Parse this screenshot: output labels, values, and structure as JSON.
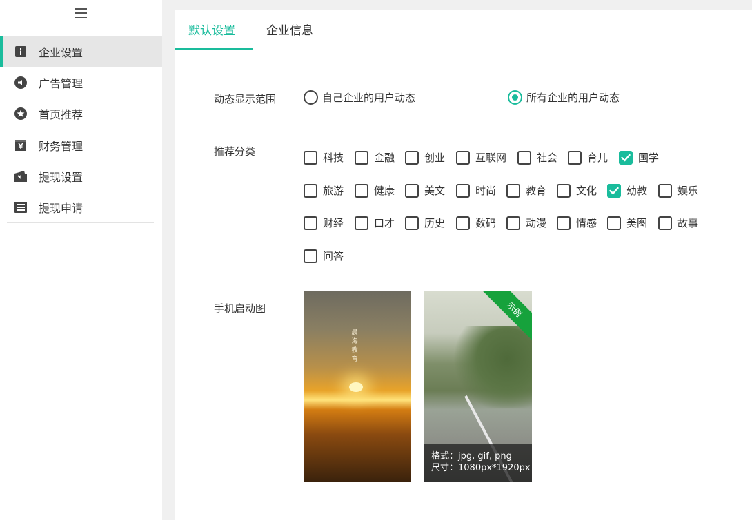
{
  "sidebar": {
    "items": [
      {
        "label": "企业设置",
        "icon": "info-icon"
      },
      {
        "label": "广告管理",
        "icon": "megaphone-icon"
      },
      {
        "label": "首页推荐",
        "icon": "star-icon"
      },
      {
        "label": "财务管理",
        "icon": "yen-icon"
      },
      {
        "label": "提现设置",
        "icon": "wallet-icon"
      },
      {
        "label": "提现申请",
        "icon": "list-icon"
      }
    ]
  },
  "tabs": [
    {
      "label": "默认设置"
    },
    {
      "label": "企业信息"
    }
  ],
  "settings": {
    "scope_label": "动态显示范围",
    "scope_options": [
      {
        "label": "自己企业的用户动态",
        "checked": false
      },
      {
        "label": "所有企业的用户动态",
        "checked": true
      }
    ],
    "category_label": "推荐分类",
    "categories": [
      {
        "label": "科技",
        "checked": false
      },
      {
        "label": "金融",
        "checked": false
      },
      {
        "label": "创业",
        "checked": false
      },
      {
        "label": "互联网",
        "checked": false
      },
      {
        "label": "社会",
        "checked": false
      },
      {
        "label": "育儿",
        "checked": false
      },
      {
        "label": "国学",
        "checked": true
      },
      {
        "label": "旅游",
        "checked": false
      },
      {
        "label": "健康",
        "checked": false
      },
      {
        "label": "美文",
        "checked": false
      },
      {
        "label": "时尚",
        "checked": false
      },
      {
        "label": "教育",
        "checked": false
      },
      {
        "label": "文化",
        "checked": false
      },
      {
        "label": "幼教",
        "checked": true
      },
      {
        "label": "娱乐",
        "checked": false
      },
      {
        "label": "财经",
        "checked": false
      },
      {
        "label": "口才",
        "checked": false
      },
      {
        "label": "历史",
        "checked": false
      },
      {
        "label": "数码",
        "checked": false
      },
      {
        "label": "动漫",
        "checked": false
      },
      {
        "label": "情感",
        "checked": false
      },
      {
        "label": "美图",
        "checked": false
      },
      {
        "label": "故事",
        "checked": false
      },
      {
        "label": "问答",
        "checked": false
      }
    ],
    "splash_label": "手机启动图",
    "splash_image_text": "晨海教育",
    "example_ribbon": "示例",
    "format_text": "格式：jpg, gif, png",
    "size_text": "尺寸：1080px*1920px"
  },
  "colors": {
    "accent": "#1abc9c",
    "ribbon": "#16a23c"
  }
}
